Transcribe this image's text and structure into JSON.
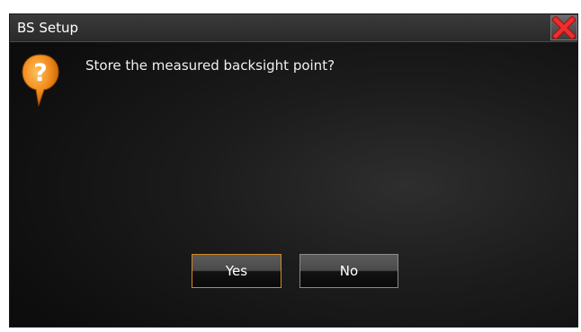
{
  "dialog": {
    "title": "BS Setup",
    "message": "Store the measured backsight point?",
    "icons": {
      "close": "close-icon",
      "question": "question-icon"
    }
  },
  "buttons": {
    "yes_label": "Yes",
    "no_label": "No"
  },
  "colors": {
    "accent": "#d2872a",
    "close_red": "#e02020",
    "icon_orange": "#f08a1c"
  }
}
